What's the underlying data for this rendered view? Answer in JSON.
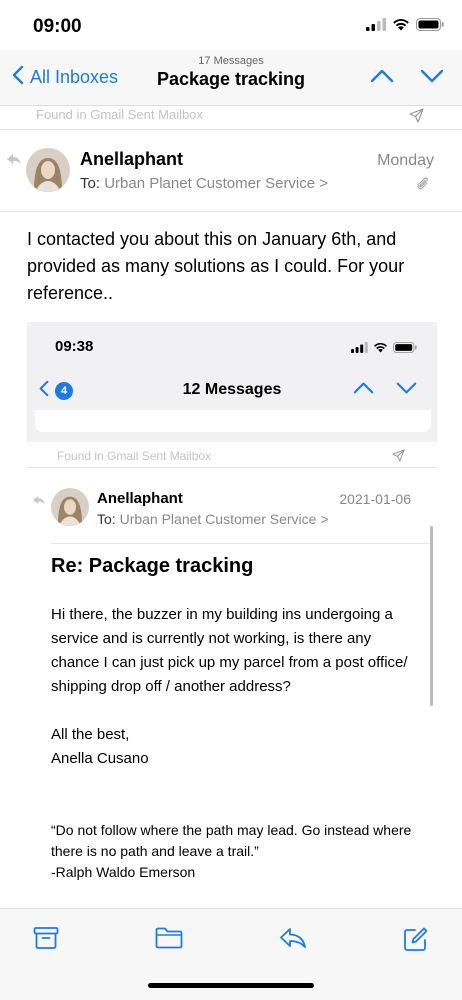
{
  "status_bar": {
    "time": "09:00"
  },
  "nav": {
    "back_label": "All Inboxes",
    "message_count": "17 Messages",
    "title": "Package tracking"
  },
  "found_in": "Found in Gmail Sent Mailbox",
  "message": {
    "sender": "Anellaphant",
    "date": "Monday",
    "to_label": "To:",
    "to_value": "Urban Planet Customer Service",
    "to_chevron": ">",
    "body": "I contacted you about this on January 6th, and provided as many solutions as I could. For your reference.."
  },
  "embedded": {
    "time": "09:38",
    "badge": "4",
    "title": "12 Messages",
    "found_in": "Found in Gmail Sent Mailbox",
    "sender": "Anellaphant",
    "date": "2021-01-06",
    "to_label": "To:",
    "to_value": "Urban Planet Customer Service",
    "to_chevron": ">",
    "subject": "Re: Package tracking",
    "body": "Hi there, the buzzer in my building ins undergoing a service and is currently not working, is there any chance I can just pick up my parcel from a post office/ shipping drop off / another address?",
    "signoff": "All the best,",
    "signature_name": "Anella Cusano",
    "quote": "“Do not follow where the path may lead. Go instead where there is no path and leave a trail.”",
    "quote_author": "-Ralph Waldo Emerson"
  },
  "toolbar": {
    "icons": [
      "archive-icon",
      "folder-icon",
      "reply-icon",
      "compose-icon"
    ]
  },
  "colors": {
    "accent": "#1f7ae0",
    "muted": "#888888"
  }
}
